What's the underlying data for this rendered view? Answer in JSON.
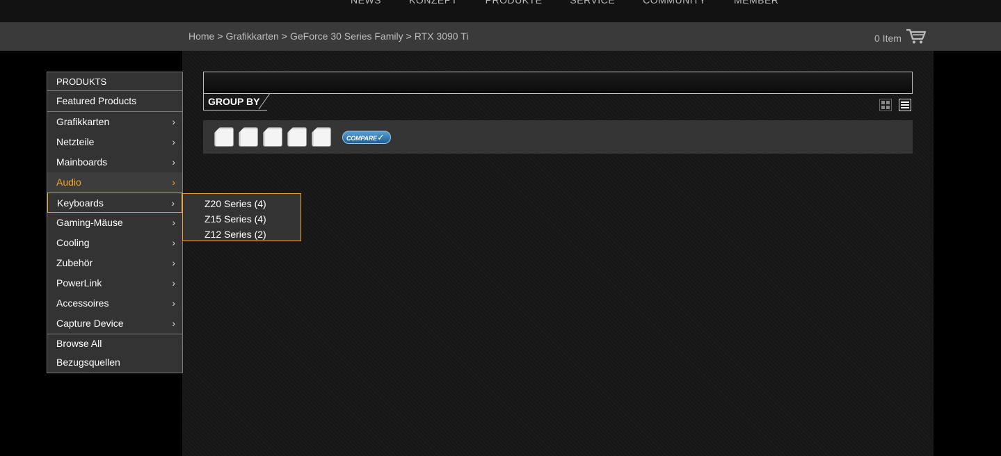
{
  "topnav": {
    "items": [
      "NEWS",
      "KONZEPT",
      "PRODUKTE",
      "SERVICE",
      "COMMUNITY",
      "MEMBER"
    ]
  },
  "breadcrumb": {
    "items": [
      "Home",
      "Grafikkarten",
      "GeForce 30 Series Family",
      "RTX 3090 Ti"
    ],
    "separator": ">"
  },
  "cart": {
    "count_label": "0 Item",
    "icon": "shopping-cart-icon"
  },
  "content": {
    "group_by_label": "GROUP BY",
    "view_modes": [
      "grid-view-icon",
      "list-view-icon"
    ],
    "compare_button": "COMPARE"
  },
  "menu": {
    "title": "PRODUKTS",
    "featured": "Featured Products",
    "categories": [
      {
        "label": "Grafikkarten"
      },
      {
        "label": "Netzteile"
      },
      {
        "label": "Mainboards"
      },
      {
        "label": "Audio"
      },
      {
        "label": "Keyboards"
      },
      {
        "label": "Gaming-Mäuse"
      },
      {
        "label": "Cooling"
      },
      {
        "label": "Zubehör"
      },
      {
        "label": "PowerLink"
      },
      {
        "label": "Accessoires"
      },
      {
        "label": "Capture Device"
      }
    ],
    "browse_all": "Browse All",
    "bezugsquellen": "Bezugsquellen"
  },
  "flyout": {
    "items": [
      {
        "label": "Z20 Series (4)"
      },
      {
        "label": "Z15 Series (4)"
      },
      {
        "label": "Z12 Series (2)"
      }
    ]
  },
  "colors": {
    "accent": "#f5a623",
    "hover_border": "#e8a63a",
    "page_bg": "#000000",
    "panel_bg": "#1a1a1a",
    "bar_bg": "#3a3a3a"
  }
}
